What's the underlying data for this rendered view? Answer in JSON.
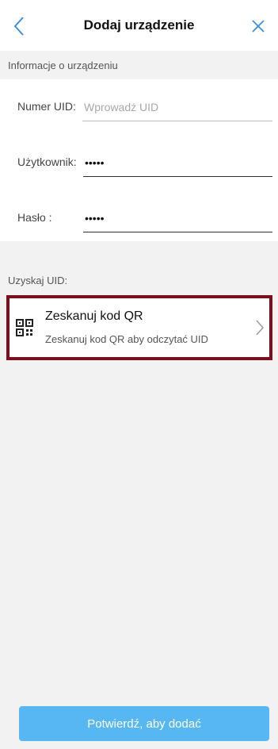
{
  "header": {
    "title": "Dodaj urządzenie",
    "back_icon": "chevron-left-icon",
    "close_icon": "close-icon"
  },
  "device_info": {
    "section_label": "Informacje o urządzeniu",
    "uid": {
      "label": "Numer UID:",
      "value": "",
      "placeholder": "Wprowadź UID"
    },
    "user": {
      "label": "Użytkownik:",
      "value": "•••••"
    },
    "password": {
      "label": "Hasło :",
      "value": "•••••"
    }
  },
  "get_uid": {
    "section_label": "Uzyskaj UID:",
    "scan": {
      "title": "Zeskanuj kod QR",
      "subtitle": "Zeskanuj kod QR aby odczytać UID",
      "icon": "qr-code-icon",
      "arrow_icon": "chevron-right-icon"
    }
  },
  "footer": {
    "confirm_label": "Potwierdź, aby dodać"
  },
  "colors": {
    "accent": "#3a8fe0",
    "button": "#57b7f3",
    "highlight_border": "#7a0f1e",
    "background": "#f2f2f2"
  }
}
